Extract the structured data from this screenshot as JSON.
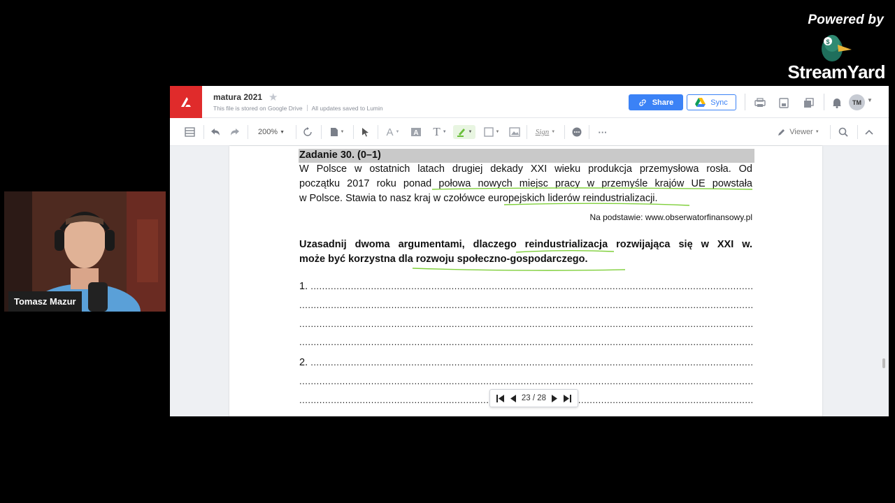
{
  "branding": {
    "powered_by": "Powered by",
    "name": "StreamYard"
  },
  "webcam": {
    "name": "Tomasz Mazur"
  },
  "editor": {
    "doc_title": "matura 2021",
    "storage_note": "This file is stored on Google Drive",
    "save_status": "All updates saved to Lumin",
    "share_label": "Share",
    "sync_label": "Sync",
    "avatar_initials": "TM",
    "zoom": "200%",
    "viewer_label": "Viewer",
    "sign_label": "Sign",
    "more_label": "···",
    "accent": "#3b82f6",
    "brand_red": "#e02b2b",
    "highlight_green": "#7fcf3a"
  },
  "document": {
    "task_heading": "Zadanie 30. (0–1)",
    "paragraph": [
      "W Polsce w ostatnich latach drugiej dekady XXI wieku produkcja przemysłowa rosła. Od",
      "początku 2017 roku ponad połowa nowych miejsc pracy w przemyśle krajów UE powstała",
      "w Polsce. Stawia to nasz kraj w czołówce europejskich liderów reindustrializacji."
    ],
    "source": "Na podstawie: www.obserwatorfinansowy.pl",
    "question": [
      "Uzasadnij dwoma argumentami, dlaczego reindustrializacja rozwijająca się w XXI w.",
      "może być korzystna dla rozwoju społeczno-gospodarczego."
    ],
    "answer_1_label": "1.",
    "answer_2_label": "2."
  },
  "pager": {
    "current": 23,
    "total": 28,
    "display": "23 / 28"
  }
}
